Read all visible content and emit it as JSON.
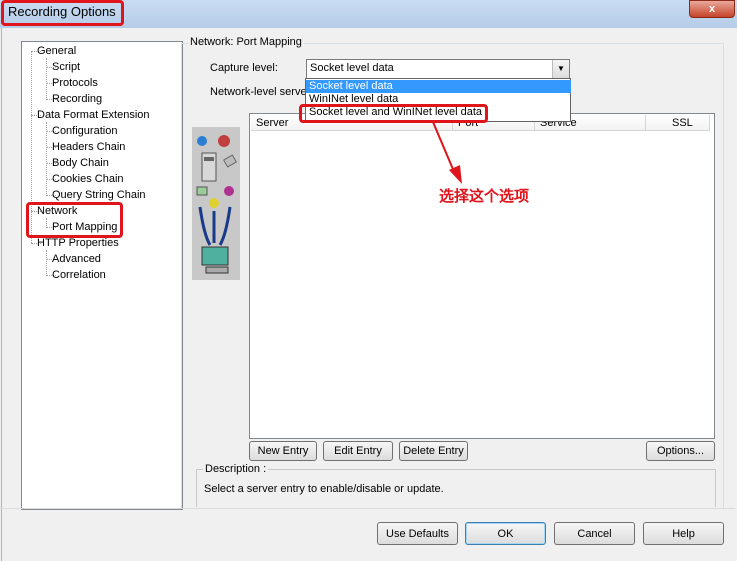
{
  "window": {
    "title": "Recording Options",
    "close_glyph": "x"
  },
  "tree": {
    "items": [
      {
        "label": "General",
        "level": 0
      },
      {
        "label": "Script",
        "level": 1
      },
      {
        "label": "Protocols",
        "level": 1
      },
      {
        "label": "Recording",
        "level": 1
      },
      {
        "label": "Data Format Extension",
        "level": 0
      },
      {
        "label": "Configuration",
        "level": 1
      },
      {
        "label": "Headers Chain",
        "level": 1
      },
      {
        "label": "Body Chain",
        "level": 1
      },
      {
        "label": "Cookies Chain",
        "level": 1
      },
      {
        "label": "Query String Chain",
        "level": 1
      },
      {
        "label": "Network",
        "level": 0
      },
      {
        "label": "Port Mapping",
        "level": 1
      },
      {
        "label": "HTTP Properties",
        "level": 0
      },
      {
        "label": "Advanced",
        "level": 1
      },
      {
        "label": "Correlation",
        "level": 1
      }
    ]
  },
  "panel": {
    "group_title": "Network: Port Mapping",
    "capture_label": "Capture level:",
    "capture_value": "Socket level data",
    "network_label": "Network-level server",
    "dropdown_options": [
      "Socket level data",
      "WinINet level data",
      "Socket level and WinINet level data"
    ],
    "dropdown_selected_index": 0
  },
  "list": {
    "columns": [
      "Server",
      "Port",
      "Service",
      "SSL"
    ]
  },
  "list_buttons": {
    "new": "New Entry",
    "edit": "Edit Entry",
    "delete": "Delete Entry",
    "options": "Options..."
  },
  "description": {
    "label": "Description :",
    "text": "Select a server entry to enable/disable or update."
  },
  "footer": {
    "defaults": "Use Defaults",
    "ok": "OK",
    "cancel": "Cancel",
    "help": "Help"
  },
  "annotation": {
    "text": "选择这个选项",
    "color": "#e0141b"
  }
}
